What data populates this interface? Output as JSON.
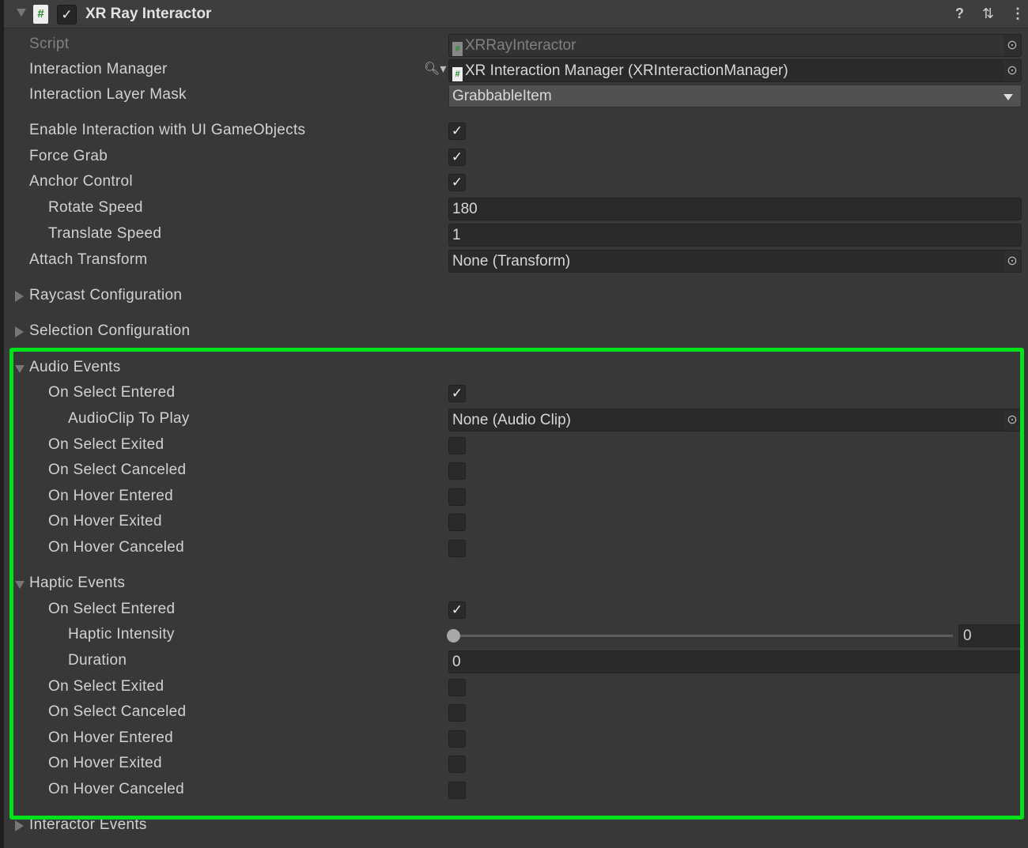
{
  "component": {
    "title": "XR Ray Interactor",
    "enabled": true,
    "script_icon": "#",
    "icons": [
      "help-icon",
      "preset-icon",
      "kebab-menu-icon"
    ]
  },
  "rows": [
    {
      "type": "object",
      "label": "Script",
      "value": "XRRayInteractor",
      "script_icon": true,
      "disabled": true,
      "indent": 0
    },
    {
      "type": "object",
      "label": "Interaction Manager",
      "value": "XR Interaction Manager (XRInteractionManager)",
      "script_icon": true,
      "search": true,
      "indent": 0
    },
    {
      "type": "dropdown",
      "label": "Interaction Layer Mask",
      "value": "GrabbableItem",
      "indent": 0
    },
    {
      "type": "checkbox",
      "label": "Enable Interaction with UI GameObjects",
      "checked": true,
      "indent": 0
    },
    {
      "type": "checkbox",
      "label": "Force Grab",
      "checked": true,
      "indent": 0
    },
    {
      "type": "checkbox",
      "label": "Anchor Control",
      "checked": true,
      "indent": 0
    },
    {
      "type": "number",
      "label": "Rotate Speed",
      "value": "180",
      "indent": 1
    },
    {
      "type": "number",
      "label": "Translate Speed",
      "value": "1",
      "indent": 1
    },
    {
      "type": "object",
      "label": "Attach Transform",
      "value": "None (Transform)",
      "indent": 0
    },
    {
      "type": "foldout",
      "label": "Raycast Configuration",
      "expanded": false,
      "indent": 0
    },
    {
      "type": "foldout",
      "label": "Selection Configuration",
      "expanded": false,
      "indent": 0
    },
    {
      "type": "foldout",
      "label": "Audio Events",
      "expanded": true,
      "indent": 0
    },
    {
      "type": "checkbox",
      "label": "On Select Entered",
      "checked": true,
      "indent": 1
    },
    {
      "type": "object",
      "label": "AudioClip To Play",
      "value": "None (Audio Clip)",
      "indent": 2
    },
    {
      "type": "checkbox",
      "label": "On Select Exited",
      "checked": false,
      "indent": 1
    },
    {
      "type": "checkbox",
      "label": "On Select Canceled",
      "checked": false,
      "indent": 1
    },
    {
      "type": "checkbox",
      "label": "On Hover Entered",
      "checked": false,
      "indent": 1
    },
    {
      "type": "checkbox",
      "label": "On Hover Exited",
      "checked": false,
      "indent": 1
    },
    {
      "type": "checkbox",
      "label": "On Hover Canceled",
      "checked": false,
      "indent": 1
    },
    {
      "type": "foldout",
      "label": "Haptic Events",
      "expanded": true,
      "indent": 0
    },
    {
      "type": "checkbox",
      "label": "On Select Entered",
      "checked": true,
      "indent": 1
    },
    {
      "type": "slider",
      "label": "Haptic Intensity",
      "value": "0",
      "fraction": 0,
      "indent": 2
    },
    {
      "type": "number",
      "label": "Duration",
      "value": "0",
      "indent": 2
    },
    {
      "type": "checkbox",
      "label": "On Select Exited",
      "checked": false,
      "indent": 1
    },
    {
      "type": "checkbox",
      "label": "On Select Canceled",
      "checked": false,
      "indent": 1
    },
    {
      "type": "checkbox",
      "label": "On Hover Entered",
      "checked": false,
      "indent": 1
    },
    {
      "type": "checkbox",
      "label": "On Hover Exited",
      "checked": false,
      "indent": 1
    },
    {
      "type": "checkbox",
      "label": "On Hover Canceled",
      "checked": false,
      "indent": 1
    },
    {
      "type": "foldout",
      "label": "Interactor Events",
      "expanded": false,
      "indent": 0
    }
  ],
  "highlight_color": "#00e21a"
}
